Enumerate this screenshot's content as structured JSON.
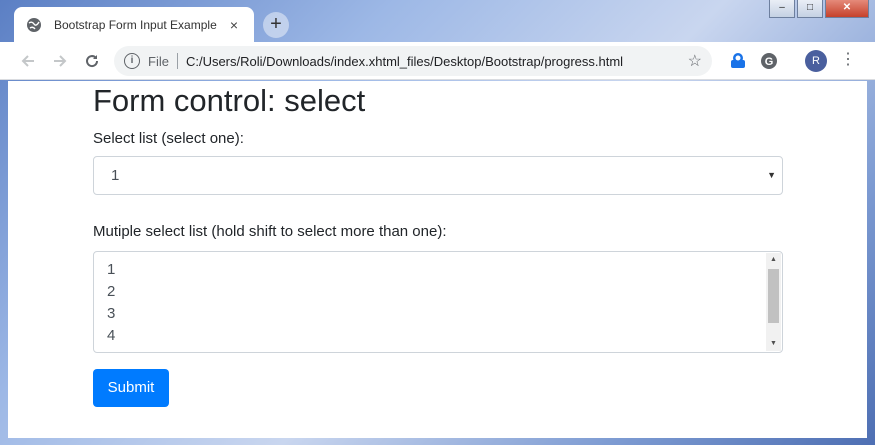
{
  "browser": {
    "tab_title": "Bootstrap Form Input Example",
    "tab_close": "×",
    "new_tab": "+",
    "window_buttons": {
      "minimize": "–",
      "maximize": "□",
      "close": "✕"
    },
    "omnibox": {
      "scheme_label": "File",
      "url": "C:/Users/Roli/Downloads/index.xhtml_files/Desktop/Bootstrap/progress.html"
    },
    "profile_initial": "R",
    "icons": [
      "back-arrow-icon",
      "forward-arrow-icon",
      "reload-icon",
      "info-icon",
      "star-icon",
      "extension-icon",
      "grammarly-icon",
      "menu-icon"
    ]
  },
  "page": {
    "heading": "Form control: select",
    "single_select": {
      "label": "Select list (select one):",
      "selected_value": "1"
    },
    "multi_select": {
      "label": "Mutiple select list (hold shift to select more than one):",
      "options": [
        "1",
        "2",
        "3",
        "4"
      ]
    },
    "submit_label": "Submit",
    "colors": {
      "primary": "#007bff",
      "border": "#ced4da",
      "text": "#212529"
    }
  }
}
